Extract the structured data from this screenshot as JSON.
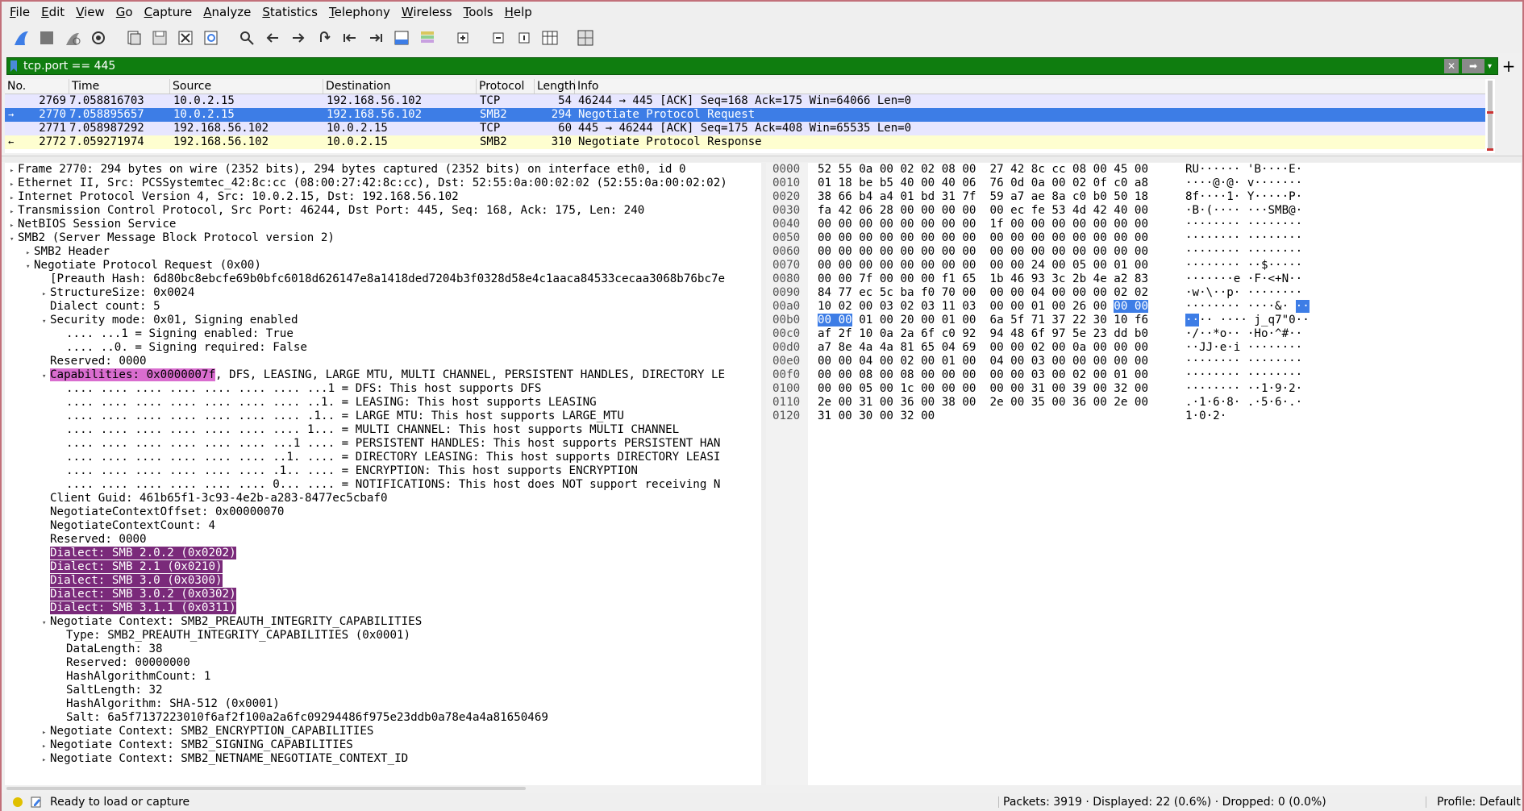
{
  "menu": [
    "File",
    "Edit",
    "View",
    "Go",
    "Capture",
    "Analyze",
    "Statistics",
    "Telephony",
    "Wireless",
    "Tools",
    "Help"
  ],
  "toolbar_icons": [
    "shark-fin-start-icon",
    "stop-square-icon",
    "restart-fin-icon",
    "gear-options-icon",
    "open-file-icon",
    "save-file-icon",
    "close-file-icon",
    "reload-icon",
    "search-icon",
    "back-arrow-icon",
    "forward-arrow-icon",
    "jump-to-packet-icon",
    "first-packet-icon",
    "last-packet-icon",
    "autoscroll-icon",
    "colorize-icon",
    "zoom-in-icon",
    "zoom-out-icon",
    "normal-size-icon",
    "resize-columns-icon",
    "table-icon"
  ],
  "filter": {
    "value": "tcp.port == 445"
  },
  "packet_list": {
    "columns": [
      "No.",
      "Time",
      "Source",
      "Destination",
      "Protocol",
      "Length",
      "Info"
    ],
    "rows": [
      {
        "no": "2769",
        "time": "7.058816703",
        "src": "10.0.2.15",
        "dst": "192.168.56.102",
        "proto": "TCP",
        "len": "54",
        "info": "46244 → 445 [ACK] Seq=168 Ack=175 Win=64066 Len=0",
        "mark": ""
      },
      {
        "no": "2770",
        "time": "7.058895657",
        "src": "10.0.2.15",
        "dst": "192.168.56.102",
        "proto": "SMB2",
        "len": "294",
        "info": "Negotiate Protocol Request",
        "mark": "→"
      },
      {
        "no": "2771",
        "time": "7.058987292",
        "src": "192.168.56.102",
        "dst": "10.0.2.15",
        "proto": "TCP",
        "len": "60",
        "info": "445 → 46244 [ACK] Seq=175 Ack=408 Win=65535 Len=0",
        "mark": ""
      },
      {
        "no": "2772",
        "time": "7.059271974",
        "src": "192.168.56.102",
        "dst": "10.0.2.15",
        "proto": "SMB2",
        "len": "310",
        "info": "Negotiate Protocol Response",
        "mark": "←"
      }
    ]
  },
  "details": [
    {
      "indent": 0,
      "arrow": "▸",
      "text": "Frame 2770: 294 bytes on wire (2352 bits), 294 bytes captured (2352 bits) on interface eth0, id 0"
    },
    {
      "indent": 0,
      "arrow": "▸",
      "text": "Ethernet II, Src: PCSSystemtec_42:8c:cc (08:00:27:42:8c:cc), Dst: 52:55:0a:00:02:02 (52:55:0a:00:02:02)"
    },
    {
      "indent": 0,
      "arrow": "▸",
      "text": "Internet Protocol Version 4, Src: 10.0.2.15, Dst: 192.168.56.102"
    },
    {
      "indent": 0,
      "arrow": "▸",
      "text": "Transmission Control Protocol, Src Port: 46244, Dst Port: 445, Seq: 168, Ack: 175, Len: 240"
    },
    {
      "indent": 0,
      "arrow": "▸",
      "text": "NetBIOS Session Service"
    },
    {
      "indent": 0,
      "arrow": "▾",
      "text": "SMB2 (Server Message Block Protocol version 2)"
    },
    {
      "indent": 1,
      "arrow": "▸",
      "text": "SMB2 Header"
    },
    {
      "indent": 1,
      "arrow": "▾",
      "text": "Negotiate Protocol Request (0x00)"
    },
    {
      "indent": 2,
      "arrow": "",
      "text": "[Preauth Hash: 6d80bc8ebcfe69b0bfc6018d626147e8a1418ded7204b3f0328d58e4c1aaca84533cecaa3068b76bc7e"
    },
    {
      "indent": 2,
      "arrow": "▸",
      "text": "StructureSize: 0x0024"
    },
    {
      "indent": 2,
      "arrow": "",
      "text": "Dialect count: 5"
    },
    {
      "indent": 2,
      "arrow": "▾",
      "text": "Security mode: 0x01, Signing enabled"
    },
    {
      "indent": 3,
      "arrow": "",
      "text": ".... ...1 = Signing enabled: True"
    },
    {
      "indent": 3,
      "arrow": "",
      "text": ".... ..0. = Signing required: False"
    },
    {
      "indent": 2,
      "arrow": "",
      "text": "Reserved: 0000"
    },
    {
      "indent": 2,
      "arrow": "▾",
      "text": "Capabilities: 0x0000007f",
      "tail": ", DFS, LEASING, LARGE MTU, MULTI CHANNEL, PERSISTENT HANDLES, DIRECTORY LE",
      "style": "cap"
    },
    {
      "indent": 3,
      "arrow": "",
      "text": ".... .... .... .... .... .... .... ...1 = DFS: This host supports DFS"
    },
    {
      "indent": 3,
      "arrow": "",
      "text": ".... .... .... .... .... .... .... ..1. = LEASING: This host supports LEASING"
    },
    {
      "indent": 3,
      "arrow": "",
      "text": ".... .... .... .... .... .... .... .1.. = LARGE MTU: This host supports LARGE_MTU"
    },
    {
      "indent": 3,
      "arrow": "",
      "text": ".... .... .... .... .... .... .... 1... = MULTI CHANNEL: This host supports MULTI CHANNEL"
    },
    {
      "indent": 3,
      "arrow": "",
      "text": ".... .... .... .... .... .... ...1 .... = PERSISTENT HANDLES: This host supports PERSISTENT HAN"
    },
    {
      "indent": 3,
      "arrow": "",
      "text": ".... .... .... .... .... .... ..1. .... = DIRECTORY LEASING: This host supports DIRECTORY LEASI"
    },
    {
      "indent": 3,
      "arrow": "",
      "text": ".... .... .... .... .... .... .1.. .... = ENCRYPTION: This host supports ENCRYPTION"
    },
    {
      "indent": 3,
      "arrow": "",
      "text": ".... .... .... .... .... .... 0... .... = NOTIFICATIONS: This host does NOT support receiving N"
    },
    {
      "indent": 2,
      "arrow": "",
      "text": "Client Guid: 461b65f1-3c93-4e2b-a283-8477ec5cbaf0"
    },
    {
      "indent": 2,
      "arrow": "",
      "text": "NegotiateContextOffset: 0x00000070"
    },
    {
      "indent": 2,
      "arrow": "",
      "text": "NegotiateContextCount: 4"
    },
    {
      "indent": 2,
      "arrow": "",
      "text": "Reserved: 0000"
    },
    {
      "indent": 2,
      "arrow": "",
      "text": "Dialect: SMB 2.0.2 (0x0202)",
      "style": "dialect"
    },
    {
      "indent": 2,
      "arrow": "",
      "text": "Dialect: SMB 2.1 (0x0210)",
      "style": "dialect"
    },
    {
      "indent": 2,
      "arrow": "",
      "text": "Dialect: SMB 3.0 (0x0300)",
      "style": "dialect"
    },
    {
      "indent": 2,
      "arrow": "",
      "text": "Dialect: SMB 3.0.2 (0x0302)",
      "style": "dialect"
    },
    {
      "indent": 2,
      "arrow": "",
      "text": "Dialect: SMB 3.1.1 (0x0311)",
      "style": "dialect"
    },
    {
      "indent": 2,
      "arrow": "▾",
      "text": "Negotiate Context: SMB2_PREAUTH_INTEGRITY_CAPABILITIES"
    },
    {
      "indent": 3,
      "arrow": "",
      "text": "Type: SMB2_PREAUTH_INTEGRITY_CAPABILITIES (0x0001)"
    },
    {
      "indent": 3,
      "arrow": "",
      "text": "DataLength: 38"
    },
    {
      "indent": 3,
      "arrow": "",
      "text": "Reserved: 00000000"
    },
    {
      "indent": 3,
      "arrow": "",
      "text": "HashAlgorithmCount: 1"
    },
    {
      "indent": 3,
      "arrow": "",
      "text": "SaltLength: 32"
    },
    {
      "indent": 3,
      "arrow": "",
      "text": "HashAlgorithm: SHA-512 (0x0001)"
    },
    {
      "indent": 3,
      "arrow": "",
      "text": "Salt: 6a5f7137223010f6af2f100a2a6fc09294486f975e23ddb0a78e4a4a81650469"
    },
    {
      "indent": 2,
      "arrow": "▸",
      "text": "Negotiate Context: SMB2_ENCRYPTION_CAPABILITIES"
    },
    {
      "indent": 2,
      "arrow": "▸",
      "text": "Negotiate Context: SMB2_SIGNING_CAPABILITIES"
    },
    {
      "indent": 2,
      "arrow": "▸",
      "text": "Negotiate Context: SMB2_NETNAME_NEGOTIATE_CONTEXT_ID"
    }
  ],
  "bytes": [
    {
      "off": "0000",
      "hex": "52 55 0a 00 02 02 08 00  27 42 8c cc 08 00 45 00",
      "asc": "RU······ 'B····E·"
    },
    {
      "off": "0010",
      "hex": "01 18 be b5 40 00 40 06  76 0d 0a 00 02 0f c0 a8",
      "asc": "····@·@· v·······"
    },
    {
      "off": "0020",
      "hex": "38 66 b4 a4 01 bd 31 7f  59 a7 ae 8a c0 b0 50 18",
      "asc": "8f····1· Y·····P·"
    },
    {
      "off": "0030",
      "hex": "fa 42 06 28 00 00 00 00  00 ec fe 53 4d 42 40 00",
      "asc": "·B·(···· ···SMB@·"
    },
    {
      "off": "0040",
      "hex": "00 00 00 00 00 00 00 00  1f 00 00 00 00 00 00 00",
      "asc": "········ ········"
    },
    {
      "off": "0050",
      "hex": "00 00 00 00 00 00 00 00  00 00 00 00 00 00 00 00",
      "asc": "········ ········"
    },
    {
      "off": "0060",
      "hex": "00 00 00 00 00 00 00 00  00 00 00 00 00 00 00 00",
      "asc": "········ ········"
    },
    {
      "off": "0070",
      "hex": "00 00 00 00 00 00 00 00  00 00 24 00 05 00 01 00",
      "asc": "········ ··$·····"
    },
    {
      "off": "0080",
      "hex": "00 00 7f 00 00 00 f1 65  1b 46 93 3c 2b 4e a2 83",
      "asc": "·······e ·F·<+N··"
    },
    {
      "off": "0090",
      "hex": "84 77 ec 5c ba f0 70 00  00 00 04 00 00 00 02 02",
      "asc": "·w·\\··p· ········"
    },
    {
      "off": "00a0",
      "hex": "10 02 00 03 02 03 11 03  00 00 01 00 26 00 ",
      "hexsel": "00 00",
      "asc": "········ ····&·",
      "ascsel": "··"
    },
    {
      "off": "00b0",
      "hexpre": "00 00",
      "hex": " 01 00 20 00 01 00  6a 5f 71 37 22 30 10 f6",
      "ascpre": "··",
      "asc": "·· ···· j_q7\"0··"
    },
    {
      "off": "00c0",
      "hex": "af 2f 10 0a 2a 6f c0 92  94 48 6f 97 5e 23 dd b0",
      "asc": "·/··*o·· ·Ho·^#··"
    },
    {
      "off": "00d0",
      "hex": "a7 8e 4a 4a 81 65 04 69  00 00 02 00 0a 00 00 00",
      "asc": "··JJ·e·i ········"
    },
    {
      "off": "00e0",
      "hex": "00 00 04 00 02 00 01 00  04 00 03 00 00 00 00 00",
      "asc": "········ ········"
    },
    {
      "off": "00f0",
      "hex": "00 00 08 00 08 00 00 00  00 00 03 00 02 00 01 00",
      "asc": "········ ········"
    },
    {
      "off": "0100",
      "hex": "00 00 05 00 1c 00 00 00  00 00 31 00 39 00 32 00",
      "asc": "········ ··1·9·2·"
    },
    {
      "off": "0110",
      "hex": "2e 00 31 00 36 00 38 00  2e 00 35 00 36 00 2e 00",
      "asc": ".·1·6·8· .·5·6·.·"
    },
    {
      "off": "0120",
      "hex": "31 00 30 00 32 00",
      "asc": "1·0·2·"
    }
  ],
  "status": {
    "ready": "Ready to load or capture",
    "packets": "Packets: 3919 · Displayed: 22 (0.6%) · Dropped: 0 (0.0%)",
    "profile": "Profile: Default"
  },
  "colors": {
    "selected": "#3d7de6",
    "tcp_row": "#e7e6ff",
    "smb_row": "#fefed0",
    "filter_ok": "#0f7d0f",
    "highlight": "#7a2a7a"
  }
}
